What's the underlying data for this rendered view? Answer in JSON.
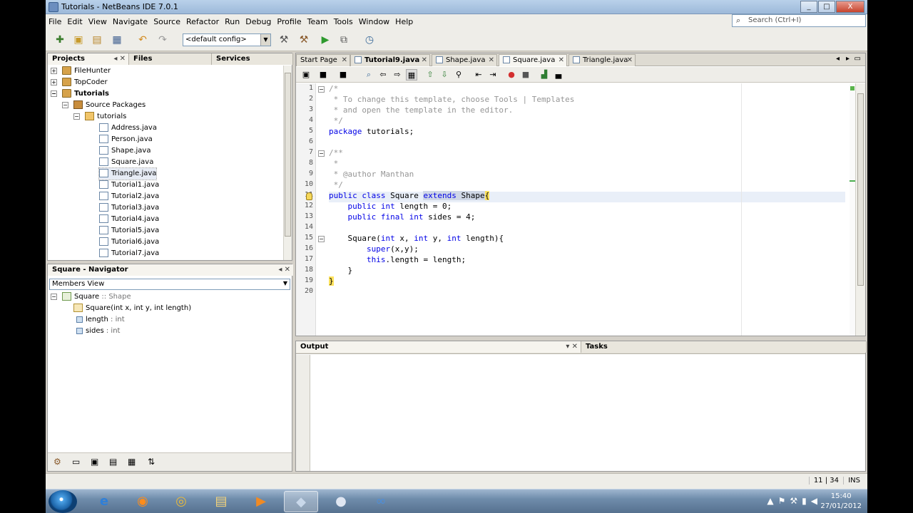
{
  "window": {
    "title": "Tutorials - NetBeans IDE 7.0.1",
    "min": "_",
    "max": "□",
    "close": "X"
  },
  "menu": [
    "File",
    "Edit",
    "View",
    "Navigate",
    "Source",
    "Refactor",
    "Run",
    "Debug",
    "Profile",
    "Team",
    "Tools",
    "Window",
    "Help"
  ],
  "toolbar": {
    "config": "<default config>",
    "search_placeholder": "Search (Ctrl+I)"
  },
  "projects_panel": {
    "tabs": [
      "Projects",
      "Files",
      "Services"
    ],
    "tree": [
      {
        "label": "FileHunter",
        "expander": "+"
      },
      {
        "label": "TopCoder",
        "expander": "+"
      },
      {
        "label": "Tutorials",
        "expander": "−"
      },
      {
        "label": "Source Packages",
        "expander": "−"
      },
      {
        "label": "tutorials",
        "expander": "−"
      },
      {
        "label": "Address.java"
      },
      {
        "label": "Person.java"
      },
      {
        "label": "Shape.java"
      },
      {
        "label": "Square.java"
      },
      {
        "label": "Triangle.java"
      },
      {
        "label": "Tutorial1.java"
      },
      {
        "label": "Tutorial2.java"
      },
      {
        "label": "Tutorial3.java"
      },
      {
        "label": "Tutorial4.java"
      },
      {
        "label": "Tutorial5.java"
      },
      {
        "label": "Tutorial6.java"
      },
      {
        "label": "Tutorial7.java"
      }
    ]
  },
  "navigator": {
    "title": "Square - Navigator",
    "view": "Members View",
    "root": {
      "name": "Square",
      "sep": " :: ",
      "super": "Shape"
    },
    "members": [
      {
        "name": "Square",
        "detail": "(int x, int y, int length)"
      },
      {
        "name": "length",
        "detail": " : int"
      },
      {
        "name": "sides",
        "detail": " : int"
      }
    ]
  },
  "editor": {
    "tabs": [
      "Start Page",
      "Tutorial9.java",
      "Shape.java",
      "Square.java",
      "Triangle.java"
    ],
    "line_numbers": [
      "1",
      "2",
      "3",
      "4",
      "5",
      "6",
      "7",
      "8",
      "9",
      "10",
      "11",
      "12",
      "13",
      "14",
      "15",
      "16",
      "17",
      "18",
      "19",
      "20"
    ],
    "fold_marker": "−"
  },
  "output": {
    "tabs": [
      "Output",
      "Tasks"
    ]
  },
  "status": {
    "position": "11 | 34",
    "mode": "INS"
  },
  "clock": {
    "time": "15:40",
    "date": "27/01/2012"
  }
}
